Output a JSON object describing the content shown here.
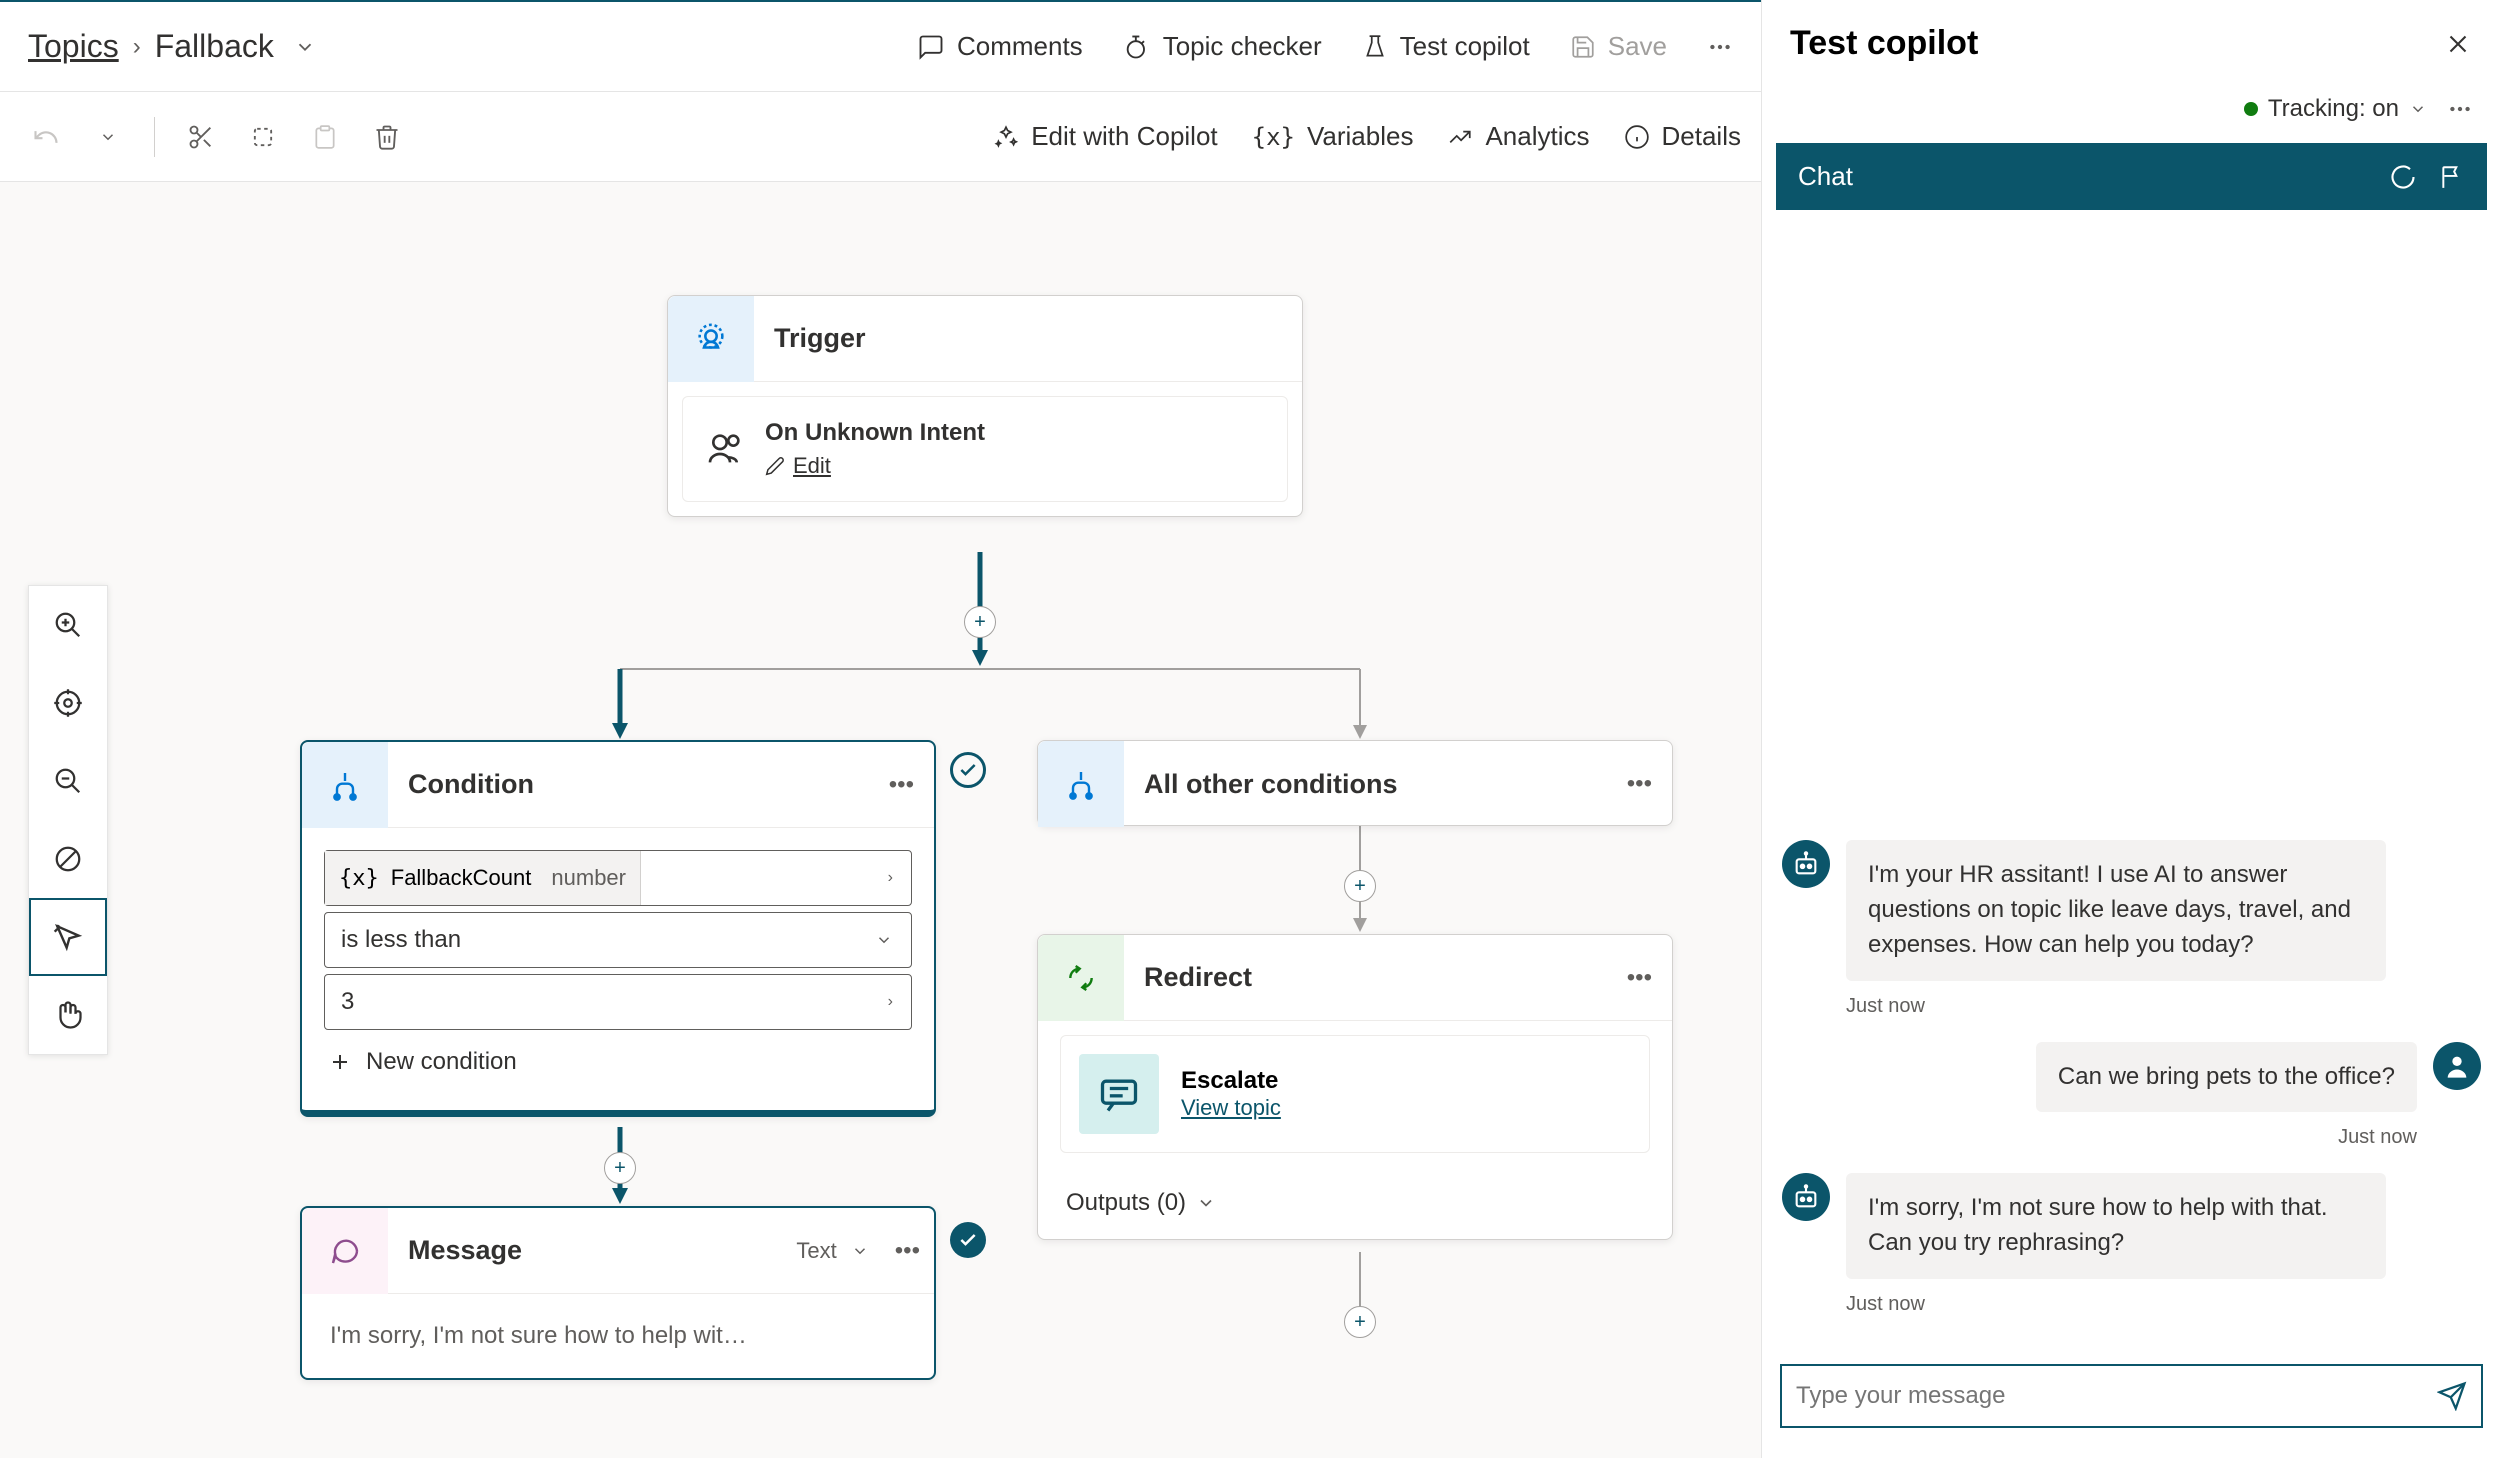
{
  "breadcrumb": {
    "root": "Topics",
    "current": "Fallback"
  },
  "topbar": {
    "comments": "Comments",
    "topic_checker": "Topic checker",
    "test_copilot": "Test copilot",
    "save": "Save"
  },
  "toolbar": {
    "edit_copilot": "Edit with Copilot",
    "variables": "Variables",
    "analytics": "Analytics",
    "details": "Details"
  },
  "nodes": {
    "trigger": {
      "title": "Trigger",
      "intent": "On Unknown Intent",
      "edit": "Edit"
    },
    "condition": {
      "title": "Condition",
      "var_name": "FallbackCount",
      "var_type": "number",
      "operator": "is less than",
      "value": "3",
      "new_condition": "New condition"
    },
    "all_other": {
      "title": "All other conditions"
    },
    "redirect": {
      "title": "Redirect",
      "target": "Escalate",
      "view_topic": "View topic",
      "outputs": "Outputs (0)"
    },
    "message": {
      "title": "Message",
      "type": "Text",
      "body": "I'm sorry, I'm not sure how to help wit…"
    }
  },
  "test": {
    "title": "Test copilot",
    "tracking": "Tracking: on",
    "chat_label": "Chat",
    "messages": {
      "bot1": "I'm your HR assitant! I use AI to answer questions on topic like leave days, travel, and expenses. How can help you today?",
      "ts1": "Just now",
      "user1": "Can we bring pets to the office?",
      "ts2": "Just now",
      "bot2": "I'm sorry, I'm not sure how to help with that. Can you try rephrasing?",
      "ts3": "Just now"
    },
    "placeholder": "Type your message"
  }
}
